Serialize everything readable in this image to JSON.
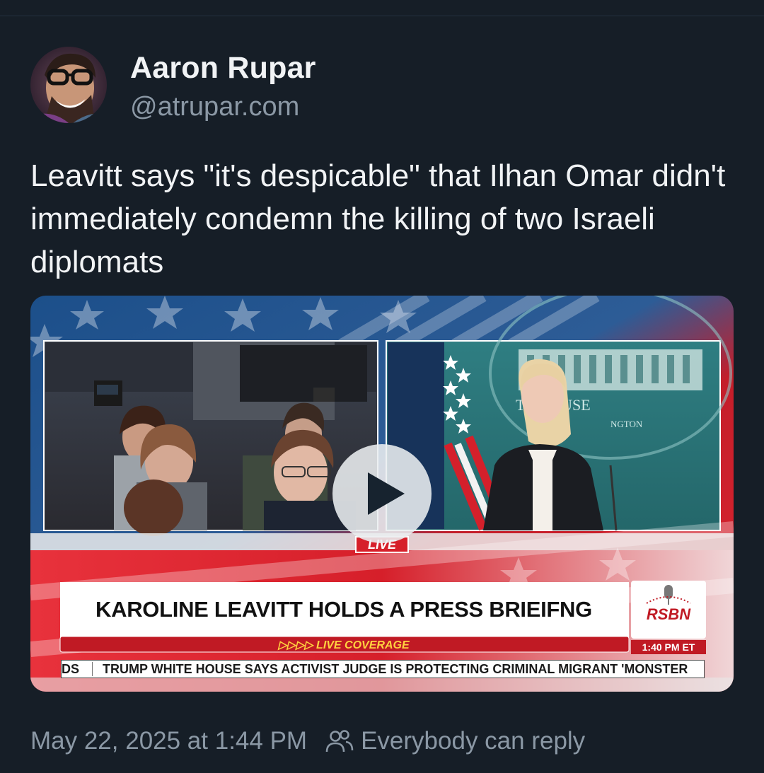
{
  "author": {
    "name": "Aaron Rupar",
    "handle": "@atrupar.com"
  },
  "post": {
    "text": "Leavitt says \"it's despicable\" that Ilhan Omar didn't immediately condemn the killing of two Israeli diplomats"
  },
  "video": {
    "live_label": "LIVE",
    "headline": "KAROLINE LEAVITT HOLDS A PRESS BRIEIFNG",
    "coverage_label": "▷▷▷▷ LIVE COVERAGE",
    "network_logo": "RSBN",
    "broadcast_time": "1:40 PM ET",
    "ticker_prefix": "DS",
    "ticker_text": "TRUMP WHITE HOUSE SAYS ACTIVIST JUDGE IS PROTECTING CRIMINAL MIGRANT 'MONSTER",
    "backdrop_text_1": "TE HOUSE",
    "backdrop_text_2": "NGTON",
    "play_icon": "play-icon"
  },
  "meta": {
    "timestamp": "May 22, 2025 at 1:44 PM",
    "reply_icon": "people-icon",
    "reply_setting": "Everybody can reply"
  },
  "colors": {
    "background": "#161e27",
    "text_primary": "#f1f3f5",
    "text_secondary": "#8b98a5",
    "broadcast_red": "#c01a24"
  }
}
